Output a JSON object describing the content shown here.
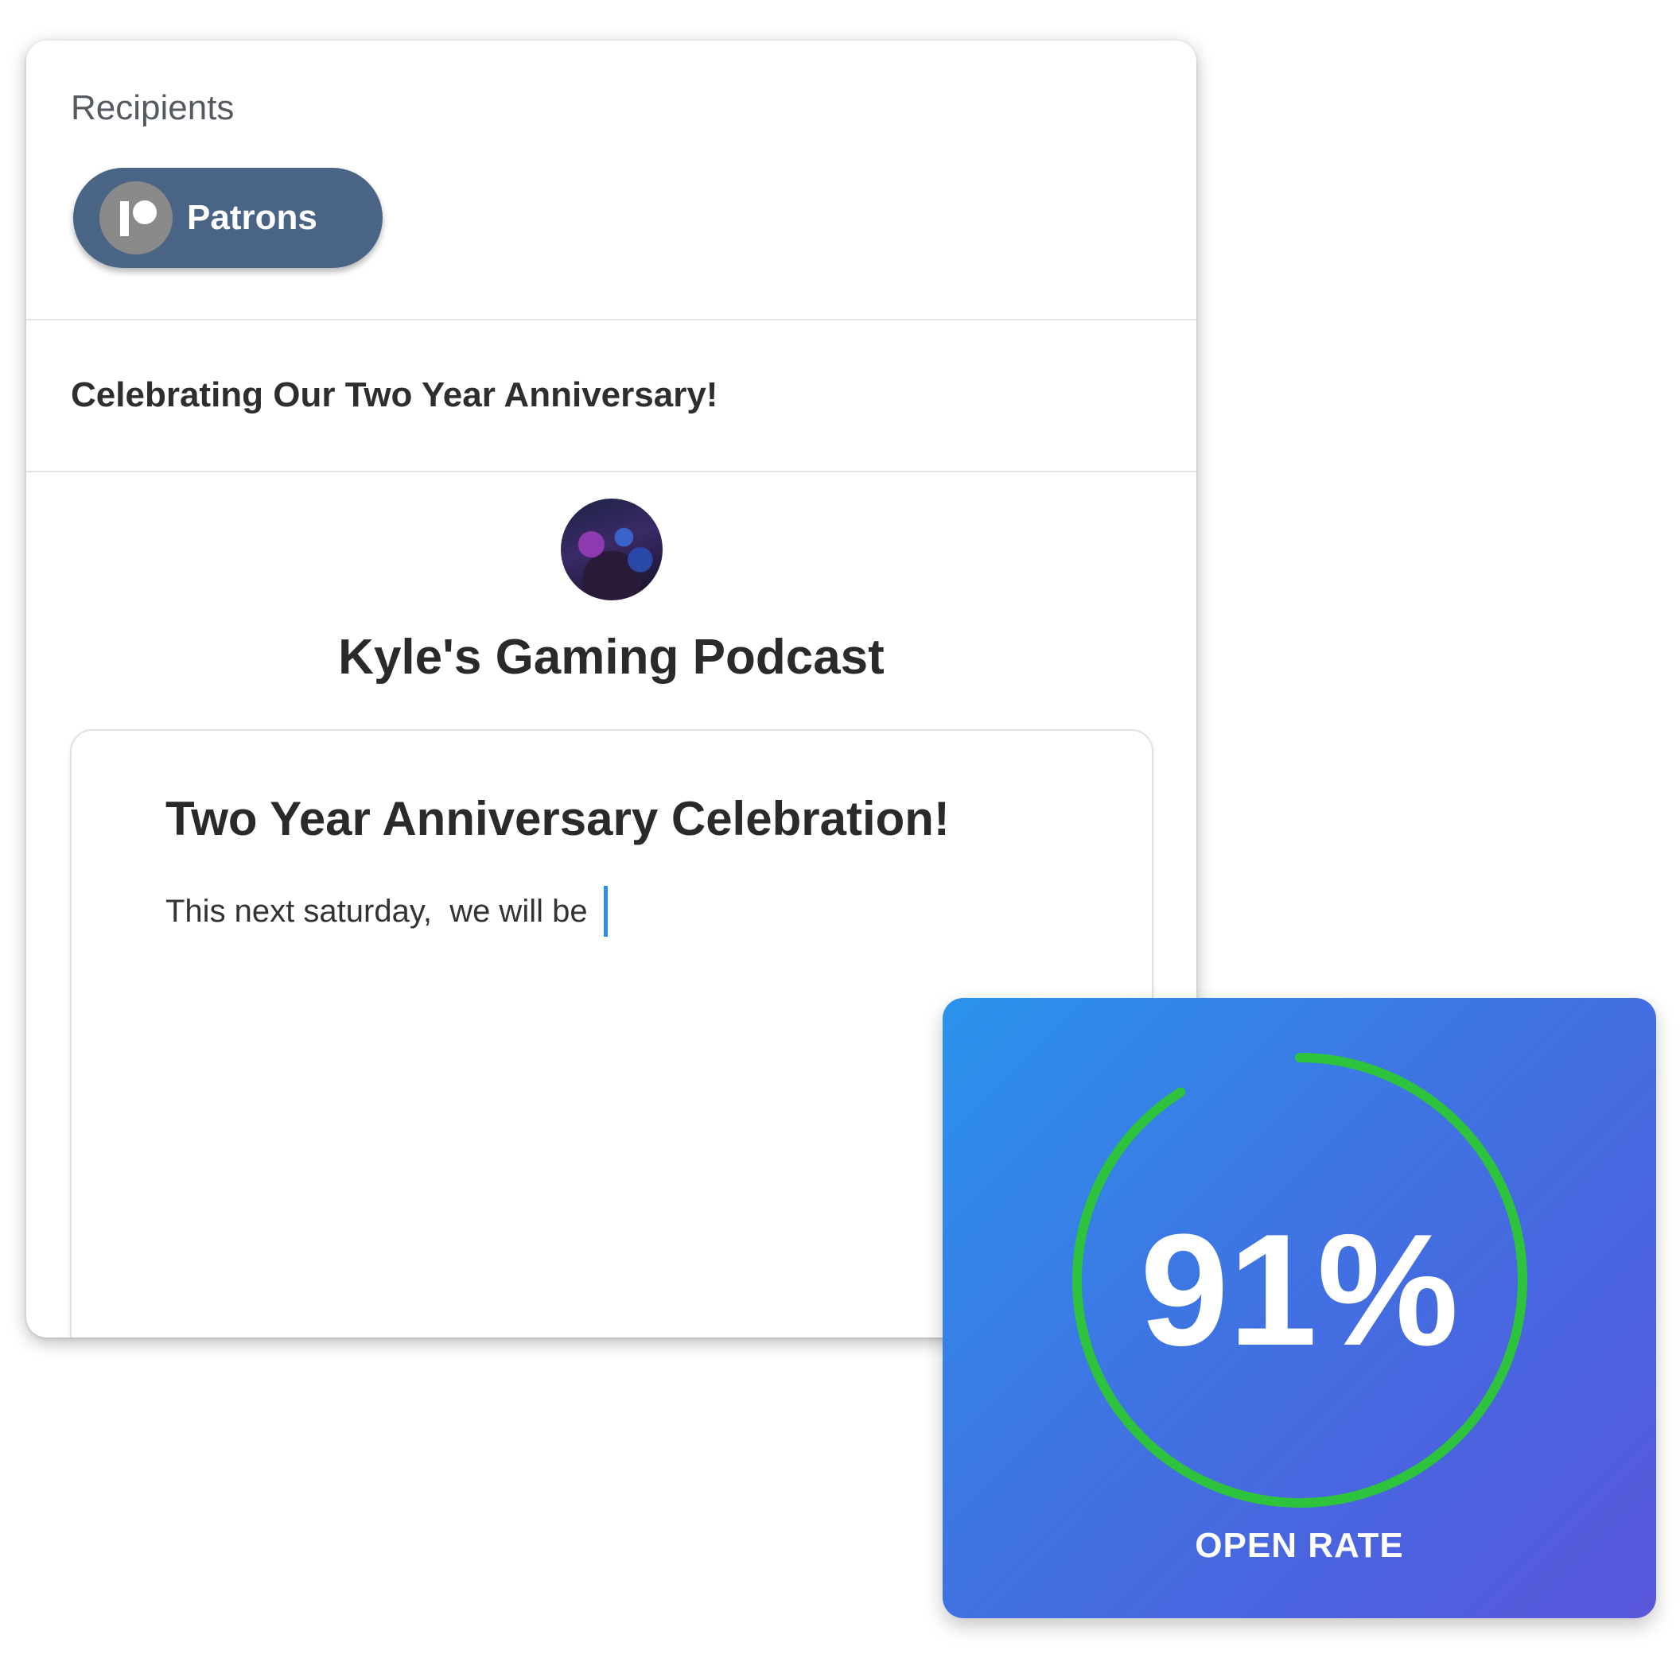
{
  "composer": {
    "recipients_label": "Recipients",
    "recipient_chip": {
      "label": "Patrons",
      "icon": "patreon-logo-icon"
    },
    "subject": "Celebrating Our Two Year Anniversary!",
    "creator_name": "Kyle's Gaming Podcast",
    "avatar": "creator-avatar-image",
    "editor": {
      "title": "Two Year Anniversary Celebration!",
      "body": "This next saturday,  we will be"
    }
  },
  "stat": {
    "value_text": "91%",
    "value": 0.91,
    "label": "OPEN RATE",
    "colors": {
      "ring": "#2ec33c",
      "gradient_start": "#2a93ec",
      "gradient_end": "#5a57db"
    }
  }
}
